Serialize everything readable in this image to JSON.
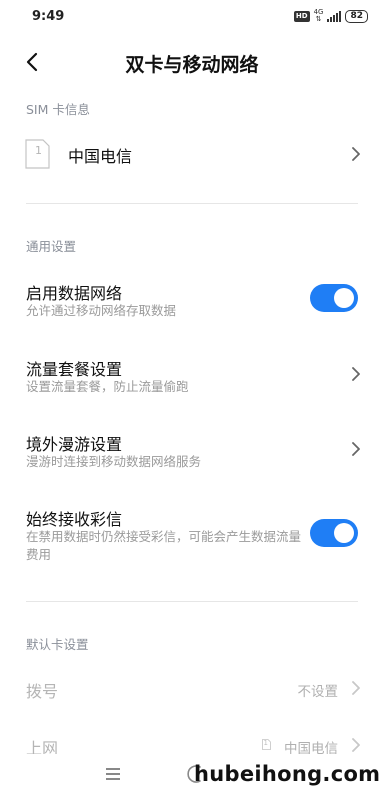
{
  "status_bar": {
    "time": "9:49",
    "hd": "HD",
    "net_type": "4G",
    "battery": "82"
  },
  "header": {
    "title": "双卡与移动网络"
  },
  "sim_info": {
    "section_label": "SIM 卡信息",
    "slot_number": "1",
    "carrier": "中国电信"
  },
  "general": {
    "section_label": "通用设置",
    "items": [
      {
        "title": "启用数据网络",
        "subtitle": "允许通过移动网络存取数据",
        "control": "toggle",
        "on": true
      },
      {
        "title": "流量套餐设置",
        "subtitle": "设置流量套餐，防止流量偷跑",
        "control": "chevron"
      },
      {
        "title": "境外漫游设置",
        "subtitle": "漫游时连接到移动数据网络服务",
        "control": "chevron"
      },
      {
        "title": "始终接收彩信",
        "subtitle": "在禁用数据时仍然接受彩信，可能会产生数据流量费用",
        "control": "toggle",
        "on": true
      }
    ]
  },
  "default_card": {
    "section_label": "默认卡设置",
    "items": [
      {
        "title": "拨号",
        "value": "不设置",
        "enabled": false
      },
      {
        "title": "上网",
        "value": "中国电信",
        "sim_slot": "1",
        "enabled": false
      }
    ]
  },
  "watermark": "hubeihong.com",
  "colors": {
    "accent": "#1f7ef5",
    "section_header": "#8a8f99",
    "subtitle": "#9a9a9a"
  }
}
